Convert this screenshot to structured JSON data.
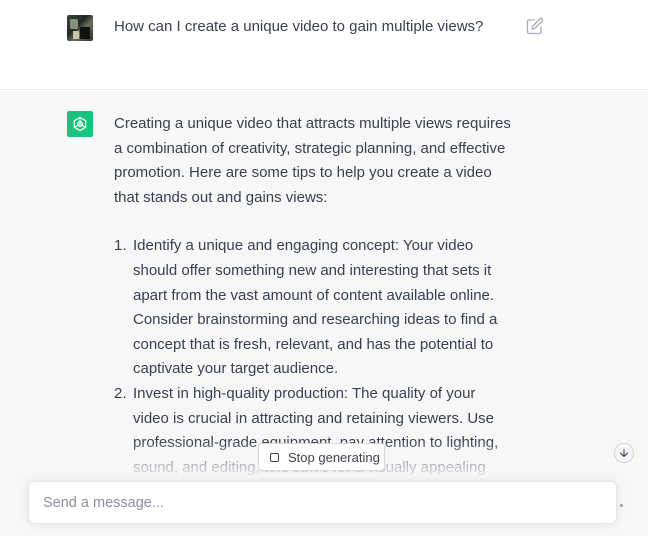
{
  "user_message": {
    "text": "How can I create a unique video to gain multiple views?",
    "avatar_icon": "user-photo-avatar",
    "edit_icon": "pencil-edit-icon"
  },
  "assistant_message": {
    "avatar_icon": "openai-logo-icon",
    "avatar_color": "#19c37d",
    "intro": "Creating a unique video that attracts multiple views requires a combination of creativity, strategic planning, and effective promotion. Here are some tips to help you create a video that stands out and gains views:",
    "items": [
      {
        "number": "1.",
        "text": "Identify a unique and engaging concept: Your video should offer something new and interesting that sets it apart from the vast amount of content available online. Consider brainstorming and researching ideas to find a concept that is fresh, relevant, and has the potential to captivate your target audience."
      },
      {
        "number": "2.",
        "text": "Invest in high-quality production: The quality of your video is crucial in attracting and retaining viewers. Use professional-grade equipment, pay attention to lighting, sound, and editing, and strive for a visually appealing and polished content that keeps viewers engaged."
      }
    ]
  },
  "controls": {
    "stop_generating_label": "Stop generating",
    "scroll_down_icon": "arrow-down-icon"
  },
  "composer": {
    "placeholder": "Send a message...",
    "value": ""
  }
}
